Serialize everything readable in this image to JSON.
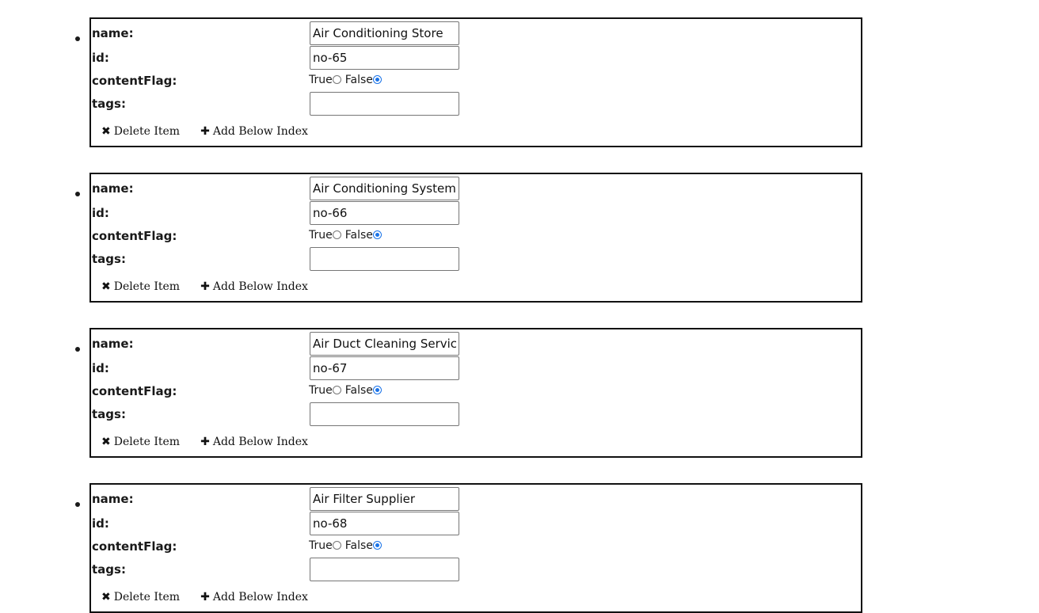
{
  "labels": {
    "name": "name:",
    "id": "id:",
    "contentFlag": "contentFlag:",
    "tags": "tags:",
    "true_label": "True",
    "false_label": "False",
    "delete_label": "Delete Item",
    "add_below_label": "Add Below Index"
  },
  "icons": {
    "delete": "times-icon",
    "add": "plus-icon"
  },
  "colors": {
    "radio_selected": "#1a73e8",
    "box_border": "#111111"
  },
  "items": [
    {
      "name": "Air Conditioning Store",
      "id": "no-65",
      "contentFlag": false,
      "tags": ""
    },
    {
      "name": "Air Conditioning System Supplier",
      "id": "no-66",
      "contentFlag": false,
      "tags": ""
    },
    {
      "name": "Air Duct Cleaning Service",
      "id": "no-67",
      "contentFlag": false,
      "tags": ""
    },
    {
      "name": "Air Filter Supplier",
      "id": "no-68",
      "contentFlag": false,
      "tags": ""
    }
  ]
}
